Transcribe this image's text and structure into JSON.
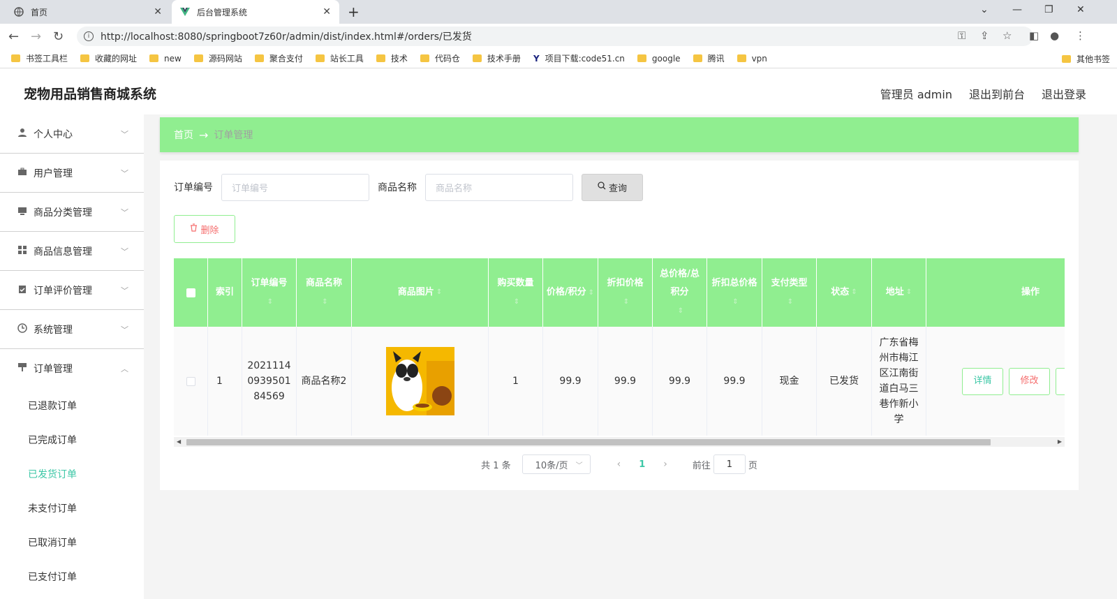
{
  "browser": {
    "tabs": [
      {
        "title": "首页"
      },
      {
        "title": "后台管理系统"
      }
    ],
    "url": "http://localhost:8080/springboot7z60r/admin/dist/index.html#/orders/已发货",
    "bookmarks": [
      "书签工具栏",
      "收藏的网址",
      "new",
      "源码网站",
      "聚合支付",
      "站长工具",
      "技术",
      "代码仓",
      "技术手册",
      "项目下载:code51.cn",
      "google",
      "腾讯",
      "vpn"
    ],
    "other_bookmarks": "其他书签"
  },
  "header": {
    "title": "宠物用品销售商城系统",
    "admin": "管理员 admin",
    "to_front": "退出到前台",
    "logout": "退出登录"
  },
  "sidebar": {
    "items": [
      {
        "label": "个人中心",
        "icon": "user-icon"
      },
      {
        "label": "用户管理",
        "icon": "briefcase-icon"
      },
      {
        "label": "商品分类管理",
        "icon": "monitor-icon"
      },
      {
        "label": "商品信息管理",
        "icon": "grid-icon"
      },
      {
        "label": "订单评价管理",
        "icon": "clipboard-icon"
      },
      {
        "label": "系统管理",
        "icon": "clock-icon"
      },
      {
        "label": "订单管理",
        "icon": "flag-icon"
      }
    ],
    "sub_items": [
      "已退款订单",
      "已完成订单",
      "已发货订单",
      "未支付订单",
      "已取消订单",
      "已支付订单"
    ],
    "active_sub": "已发货订单"
  },
  "breadcrumb": {
    "home": "首页",
    "current": "订单管理"
  },
  "search": {
    "order_label": "订单编号",
    "order_placeholder": "订单编号",
    "product_label": "商品名称",
    "product_placeholder": "商品名称",
    "query_label": "查询"
  },
  "delete_label": "删除",
  "table": {
    "headers": {
      "index": "索引",
      "order_no": "订单编号",
      "product_name": "商品名称",
      "product_image": "商品图片",
      "quantity": "购买数量",
      "price": "价格/积分",
      "discount_price": "折扣价格",
      "total": "总价格/总积分",
      "discount_total": "折扣总价格",
      "pay_type": "支付类型",
      "status": "状态",
      "address": "地址",
      "actions": "操作"
    },
    "rows": [
      {
        "index": "1",
        "order_no": "20211140939501 84569",
        "product_name": "商品名称2",
        "quantity": "1",
        "price": "99.9",
        "discount_price": "99.9",
        "total": "99.9",
        "discount_total": "99.9",
        "pay_type": "现金",
        "status": "已发货",
        "address": "广东省梅州市梅江区江南街道白马三巷作新小学"
      }
    ],
    "detail_label": "详情",
    "edit_label": "修改"
  },
  "pager": {
    "total": "共 1 条",
    "page_size": "10条/页",
    "current": "1",
    "goto_prefix": "前往",
    "goto_value": "1",
    "goto_suffix": "页"
  },
  "colors": {
    "accent": "#90ee90",
    "active_text": "#3cc7a6",
    "danger": "#f56c6c",
    "info": "#409eff"
  }
}
